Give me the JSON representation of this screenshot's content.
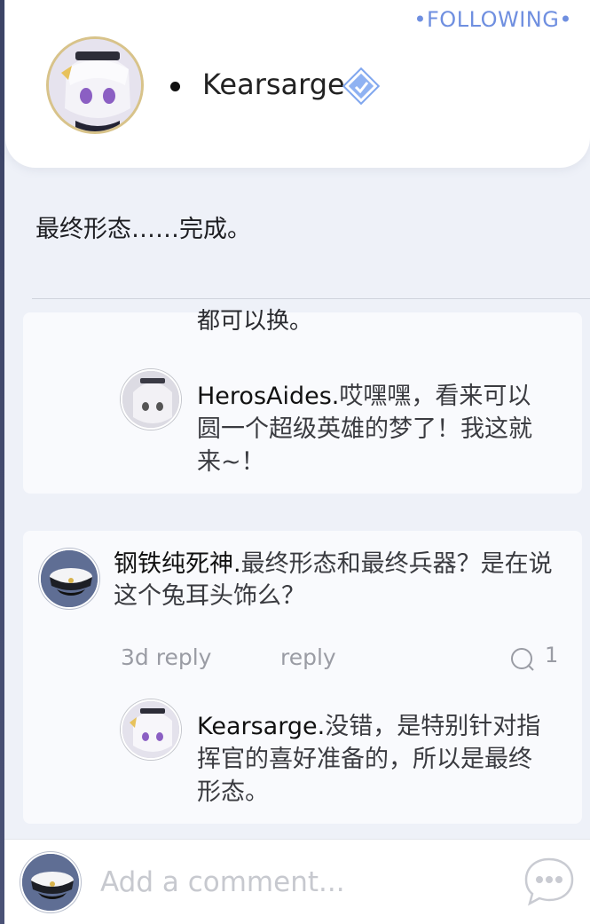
{
  "header": {
    "following_label": "•FOLLOWING•",
    "author_name": "Kearsarge",
    "avatar_icon": "kearsarge-avatar-icon",
    "verified_icon": "verified-diamond-icon",
    "accent_color": "#6f8fe0"
  },
  "post": {
    "text": "最终形态……完成。"
  },
  "comments": [
    {
      "clipped_text": "都可以换。",
      "reply": {
        "name": "HerosAides.",
        "text": "哎嘿嘿，看来可以圆一个超级英雄的梦了！我这就来~！"
      }
    },
    {
      "name": "钢铁纯死神.",
      "text": "最终形态和最终兵器？是在说这个兔耳头饰么？",
      "time_label": "3d reply",
      "reply_label": "reply",
      "reply_count": "1",
      "reply": {
        "name": "Kearsarge.",
        "text": "没错，是特别针对指挥官的喜好准备的，所以是最终形态。"
      }
    }
  ],
  "composer": {
    "placeholder": "Add a comment...",
    "more_icon": "more-dots-icon"
  }
}
